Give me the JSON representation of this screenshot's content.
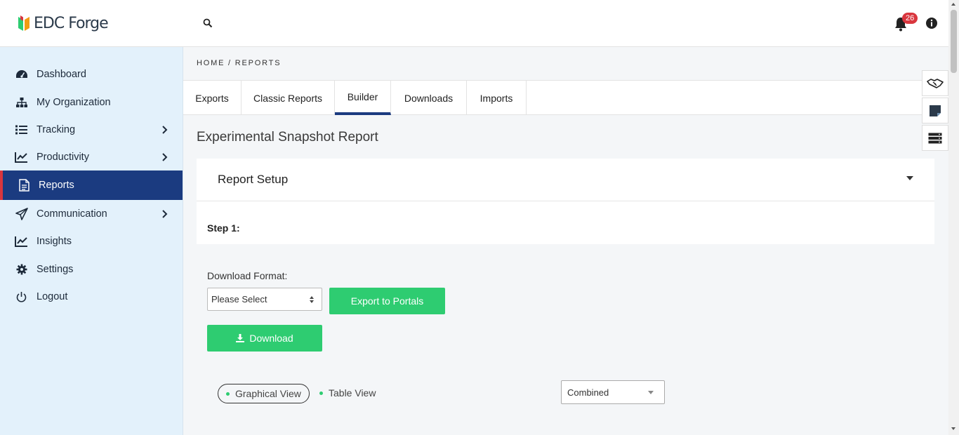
{
  "app": {
    "logo_text": "EDC Forge"
  },
  "header": {
    "notification_count": "26",
    "icons": [
      "search-icon",
      "bell-icon",
      "info-icon"
    ]
  },
  "sidebar": {
    "items": [
      {
        "label": "Dashboard",
        "icon": "dashboard-gauge-icon"
      },
      {
        "label": "My Organization",
        "icon": "org-chart-icon"
      },
      {
        "label": "Tracking",
        "icon": "list-icon",
        "has_submenu": true
      },
      {
        "label": "Productivity",
        "icon": "line-chart-icon",
        "has_submenu": true
      },
      {
        "label": "Reports",
        "icon": "document-icon",
        "active": true
      },
      {
        "label": "Communication",
        "icon": "paper-plane-icon",
        "has_submenu": true
      },
      {
        "label": "Insights",
        "icon": "line-chart-icon"
      },
      {
        "label": "Settings",
        "icon": "gear-icon"
      },
      {
        "label": "Logout",
        "icon": "power-icon"
      }
    ]
  },
  "breadcrumb": "HOME / REPORTS",
  "tabs": [
    {
      "label": "Exports"
    },
    {
      "label": "Classic Reports"
    },
    {
      "label": "Builder",
      "active": true
    },
    {
      "label": "Downloads"
    },
    {
      "label": "Imports"
    }
  ],
  "page_title": "Experimental Snapshot Report",
  "report_setup": {
    "title": "Report Setup",
    "step_label": "Step 1:"
  },
  "download": {
    "format_label": "Download Format:",
    "format_value": "Please Select",
    "export_button": "Export to Portals",
    "download_button": "Download"
  },
  "views": {
    "graphical": "Graphical View",
    "table": "Table View",
    "mode_select": "Combined"
  },
  "colors": {
    "primary": "#1b3b80",
    "accent_red": "#d9363e",
    "green": "#2ecc71",
    "sidebar_bg": "#e3f1fb"
  }
}
